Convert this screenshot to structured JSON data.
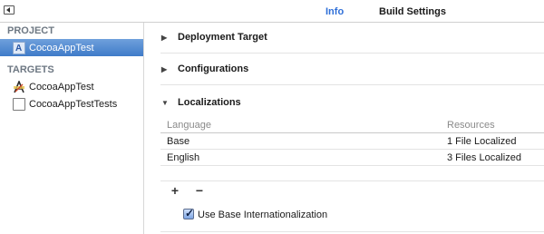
{
  "topbar": {
    "tabs": [
      {
        "label": "Info",
        "active": true
      },
      {
        "label": "Build Settings",
        "active": false
      }
    ],
    "accent_color": "#2f6fd8"
  },
  "sidebar": {
    "project_header": "PROJECT",
    "project_item": {
      "label": "CocoaAppTest",
      "icon": "xcode-project-icon",
      "selected": true
    },
    "targets_header": "TARGETS",
    "targets": [
      {
        "label": "CocoaAppTest",
        "icon": "app-target-icon"
      },
      {
        "label": "CocoaAppTestTests",
        "icon": "test-bundle-icon"
      }
    ],
    "selection_color": "#3f7bc9"
  },
  "main": {
    "groups": [
      {
        "label": "Deployment Target",
        "expanded": false
      },
      {
        "label": "Configurations",
        "expanded": false
      },
      {
        "label": "Localizations",
        "expanded": true
      }
    ],
    "localizations": {
      "columns": [
        "Language",
        "Resources"
      ],
      "rows": [
        {
          "language": "Base",
          "resources": "1 File Localized"
        },
        {
          "language": "English",
          "resources": "3 Files Localized"
        }
      ],
      "add_symbol": "+",
      "remove_symbol": "−"
    },
    "use_base_internationalization": {
      "label": "Use Base Internationalization",
      "checked": true
    }
  }
}
